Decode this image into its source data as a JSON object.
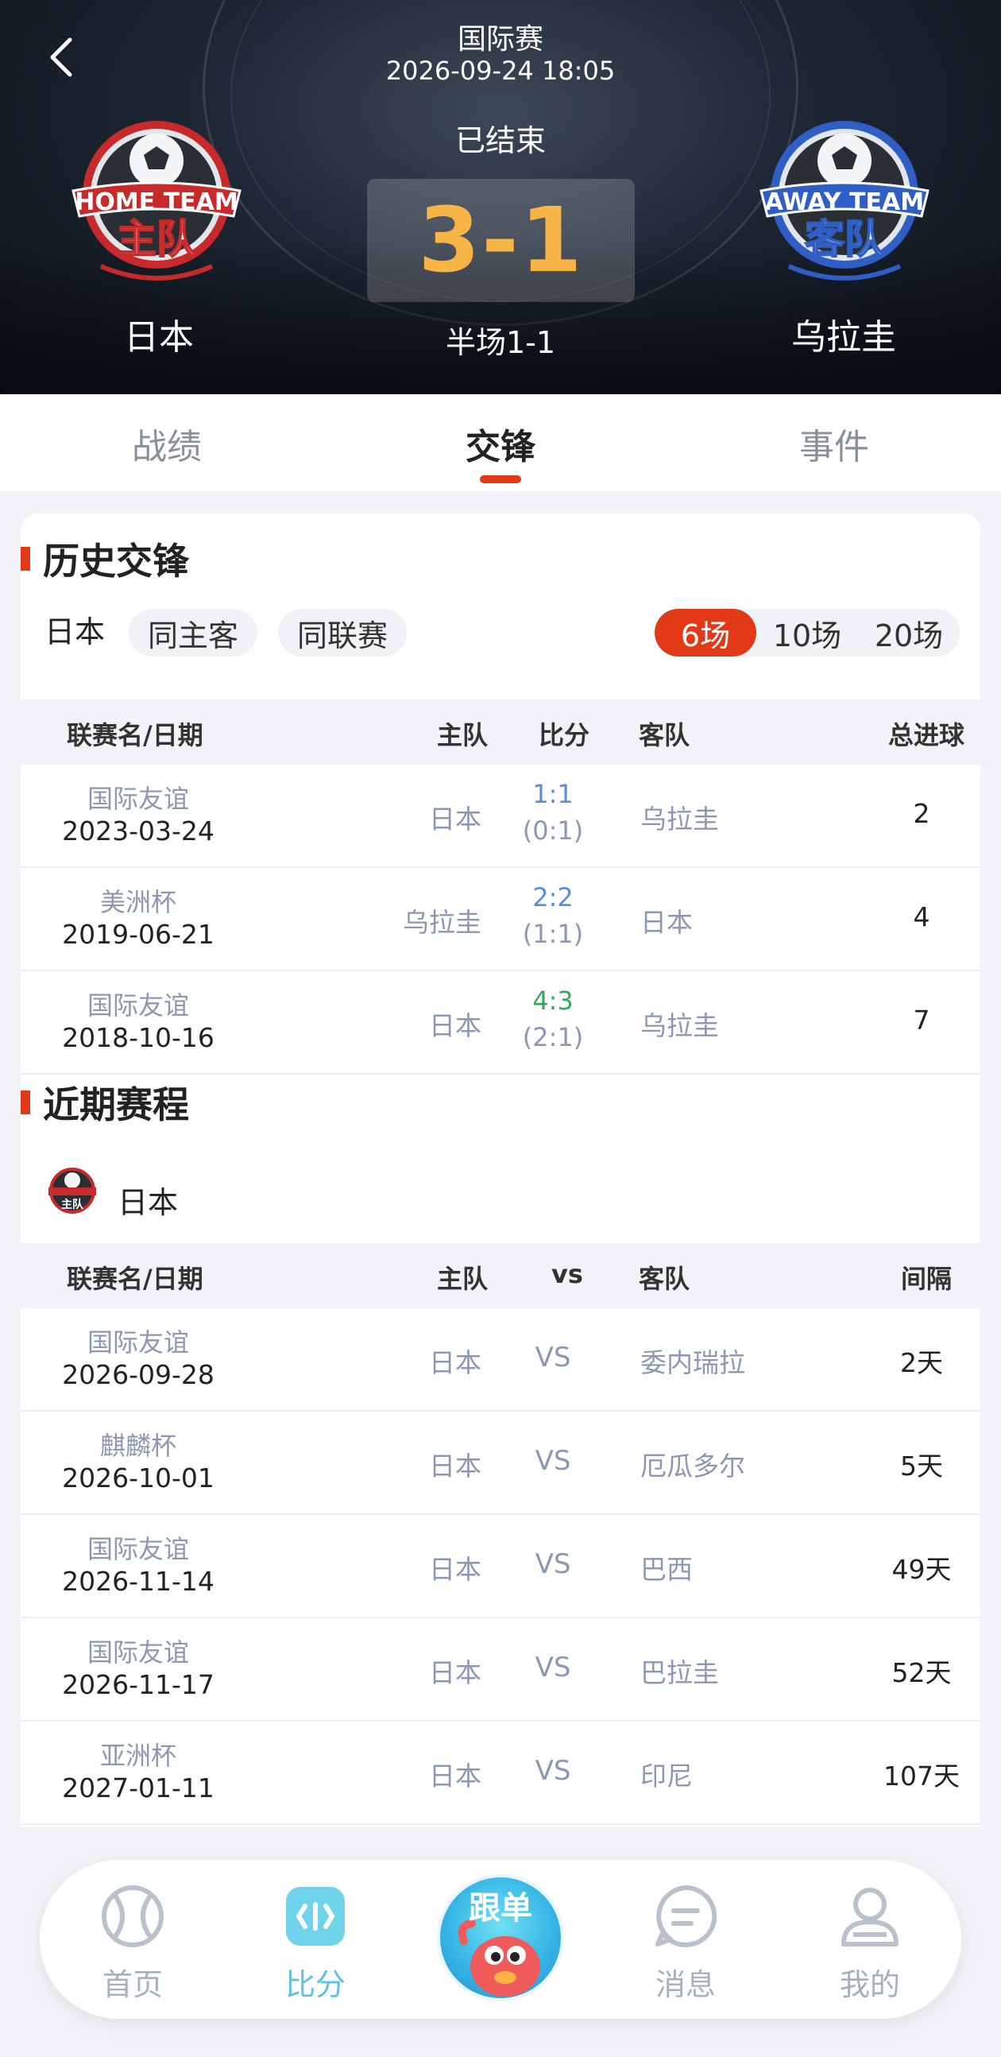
{
  "header": {
    "league": "国际赛",
    "datetime": "2026-09-24 18:05",
    "status": "已结束",
    "score": "3-1",
    "halftime": "半场1-1",
    "home_team": "日本",
    "away_team": "乌拉圭",
    "home_logo_text": "HOME TEAM 主队",
    "away_logo_text": "AWAY TEAM 客队"
  },
  "tabs": [
    {
      "label": "战绩"
    },
    {
      "label": "交锋"
    },
    {
      "label": "事件"
    }
  ],
  "h2h": {
    "title": "历史交锋",
    "team_filter": "日本",
    "chips": [
      "同主客",
      "同联赛"
    ],
    "counts": [
      "6场",
      "10场",
      "20场"
    ],
    "selected_count": "6场",
    "columns": {
      "league_date": "联赛名/日期",
      "home": "主队",
      "score": "比分",
      "away": "客队",
      "total": "总进球"
    },
    "rows": [
      {
        "league": "国际友谊",
        "date": "2023-03-24",
        "home": "日本",
        "score": "1:1",
        "ht": "(0:1)",
        "away": "乌拉圭",
        "total": "2",
        "score_color": "#5b8dd9"
      },
      {
        "league": "美洲杯",
        "date": "2019-06-21",
        "home": "乌拉圭",
        "score": "2:2",
        "ht": "(1:1)",
        "away": "日本",
        "total": "4",
        "score_color": "#5b8dd9"
      },
      {
        "league": "国际友谊",
        "date": "2018-10-16",
        "home": "日本",
        "score": "4:3",
        "ht": "(2:1)",
        "away": "乌拉圭",
        "total": "7",
        "score_color": "#3aa55f"
      }
    ]
  },
  "recent": {
    "title": "近期赛程",
    "team": "日本",
    "team_logo_text": "HOME TEAM 主队",
    "columns": {
      "league_date": "联赛名/日期",
      "home": "主队",
      "vs": "vs",
      "away": "客队",
      "interval": "间隔"
    },
    "rows": [
      {
        "league": "国际友谊",
        "date": "2026-09-28",
        "home": "日本",
        "vs": "VS",
        "away": "委内瑞拉",
        "interval": "2天"
      },
      {
        "league": "麒麟杯",
        "date": "2026-10-01",
        "home": "日本",
        "vs": "VS",
        "away": "厄瓜多尔",
        "interval": "5天"
      },
      {
        "league": "国际友谊",
        "date": "2026-11-14",
        "home": "日本",
        "vs": "VS",
        "away": "巴西",
        "interval": "49天"
      },
      {
        "league": "国际友谊",
        "date": "2026-11-17",
        "home": "日本",
        "vs": "VS",
        "away": "巴拉圭",
        "interval": "52天"
      },
      {
        "league": "亚洲杯",
        "date": "2027-01-11",
        "home": "日本",
        "vs": "VS",
        "away": "印尼",
        "interval": "107天"
      }
    ]
  },
  "nav": {
    "items": [
      {
        "label": "首页",
        "icon": "ball-icon"
      },
      {
        "label": "比分",
        "icon": "score-icon"
      },
      {
        "label": "跟单",
        "icon": "mascot-icon"
      },
      {
        "label": "消息",
        "icon": "message-icon"
      },
      {
        "label": "我的",
        "icon": "profile-icon"
      }
    ],
    "active": "比分"
  },
  "colors": {
    "accent": "#e23a17",
    "score": "#f7b548",
    "nav_active": "#5fc3dd",
    "muted": "#8c98b3"
  }
}
